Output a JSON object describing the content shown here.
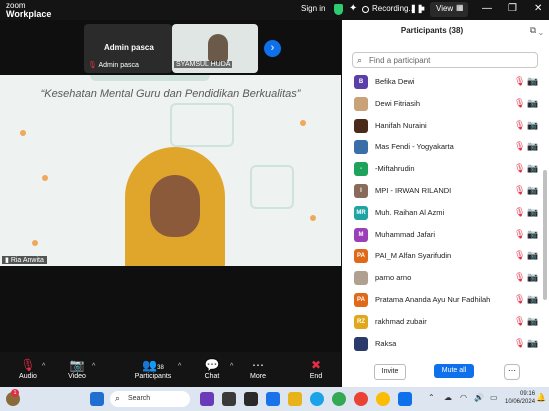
{
  "topbar": {
    "logo_line1": "zoom",
    "logo_line2": "Workplace",
    "sign_in": "Sign in",
    "recording": "Recording...",
    "view": "View"
  },
  "thumbs": [
    {
      "name": "Admin pasca",
      "label": "Admin pasca"
    },
    {
      "label": "SYAMSUL HUDA"
    }
  ],
  "video": {
    "slide_title": "“Kesehatan Mental Guru dan Pendidikan Berkualitas”",
    "label": "Ria Anwita"
  },
  "controls": {
    "audio": "Audio",
    "video": "Video",
    "participants": "Participants",
    "participants_count": "38",
    "chat": "Chat",
    "more": "More",
    "end": "End"
  },
  "panel": {
    "title": "Participants (38)",
    "search_placeholder": "Find a participant",
    "invite": "Invite",
    "mute_all": "Mute all",
    "more": "⋯"
  },
  "participants": [
    {
      "initials": "B",
      "name": "Befika Dewi",
      "color": "#5b3fa8"
    },
    {
      "initials": "",
      "name": "Dewi Fitriasih",
      "color": "#c9a27a"
    },
    {
      "initials": "",
      "name": "Hanifah Nuraini",
      "color": "#4a2a1a"
    },
    {
      "initials": "",
      "name": "Mas Fendi - Yogyakarta",
      "color": "#3a6ea8"
    },
    {
      "initials": "-",
      "name": "-Miftahrudin",
      "color": "#1fa35a"
    },
    {
      "initials": "I",
      "name": "MPI - IRWAN RILANDI",
      "color": "#8a6a5a"
    },
    {
      "initials": "MR",
      "name": "Muh. Raihan Al Azmi",
      "color": "#1fa3a3"
    },
    {
      "initials": "M",
      "name": "Muhammad Jafari",
      "color": "#9a3fb8"
    },
    {
      "initials": "PA",
      "name": "PAI_M Alfan Syarifudin",
      "color": "#e06a1a"
    },
    {
      "initials": "",
      "name": "parno arno",
      "color": "#b0a090"
    },
    {
      "initials": "PA",
      "name": "Pratama Ananda Ayu Nur Fadhilah",
      "color": "#e06a1a"
    },
    {
      "initials": "RZ",
      "name": "rakhmad zubair",
      "color": "#e0a81a"
    },
    {
      "initials": "",
      "name": "Raksa",
      "color": "#2a3a6a"
    }
  ],
  "taskbar": {
    "search": "Search",
    "time": "09:16",
    "date": "10/06/2024",
    "badge": "1"
  }
}
